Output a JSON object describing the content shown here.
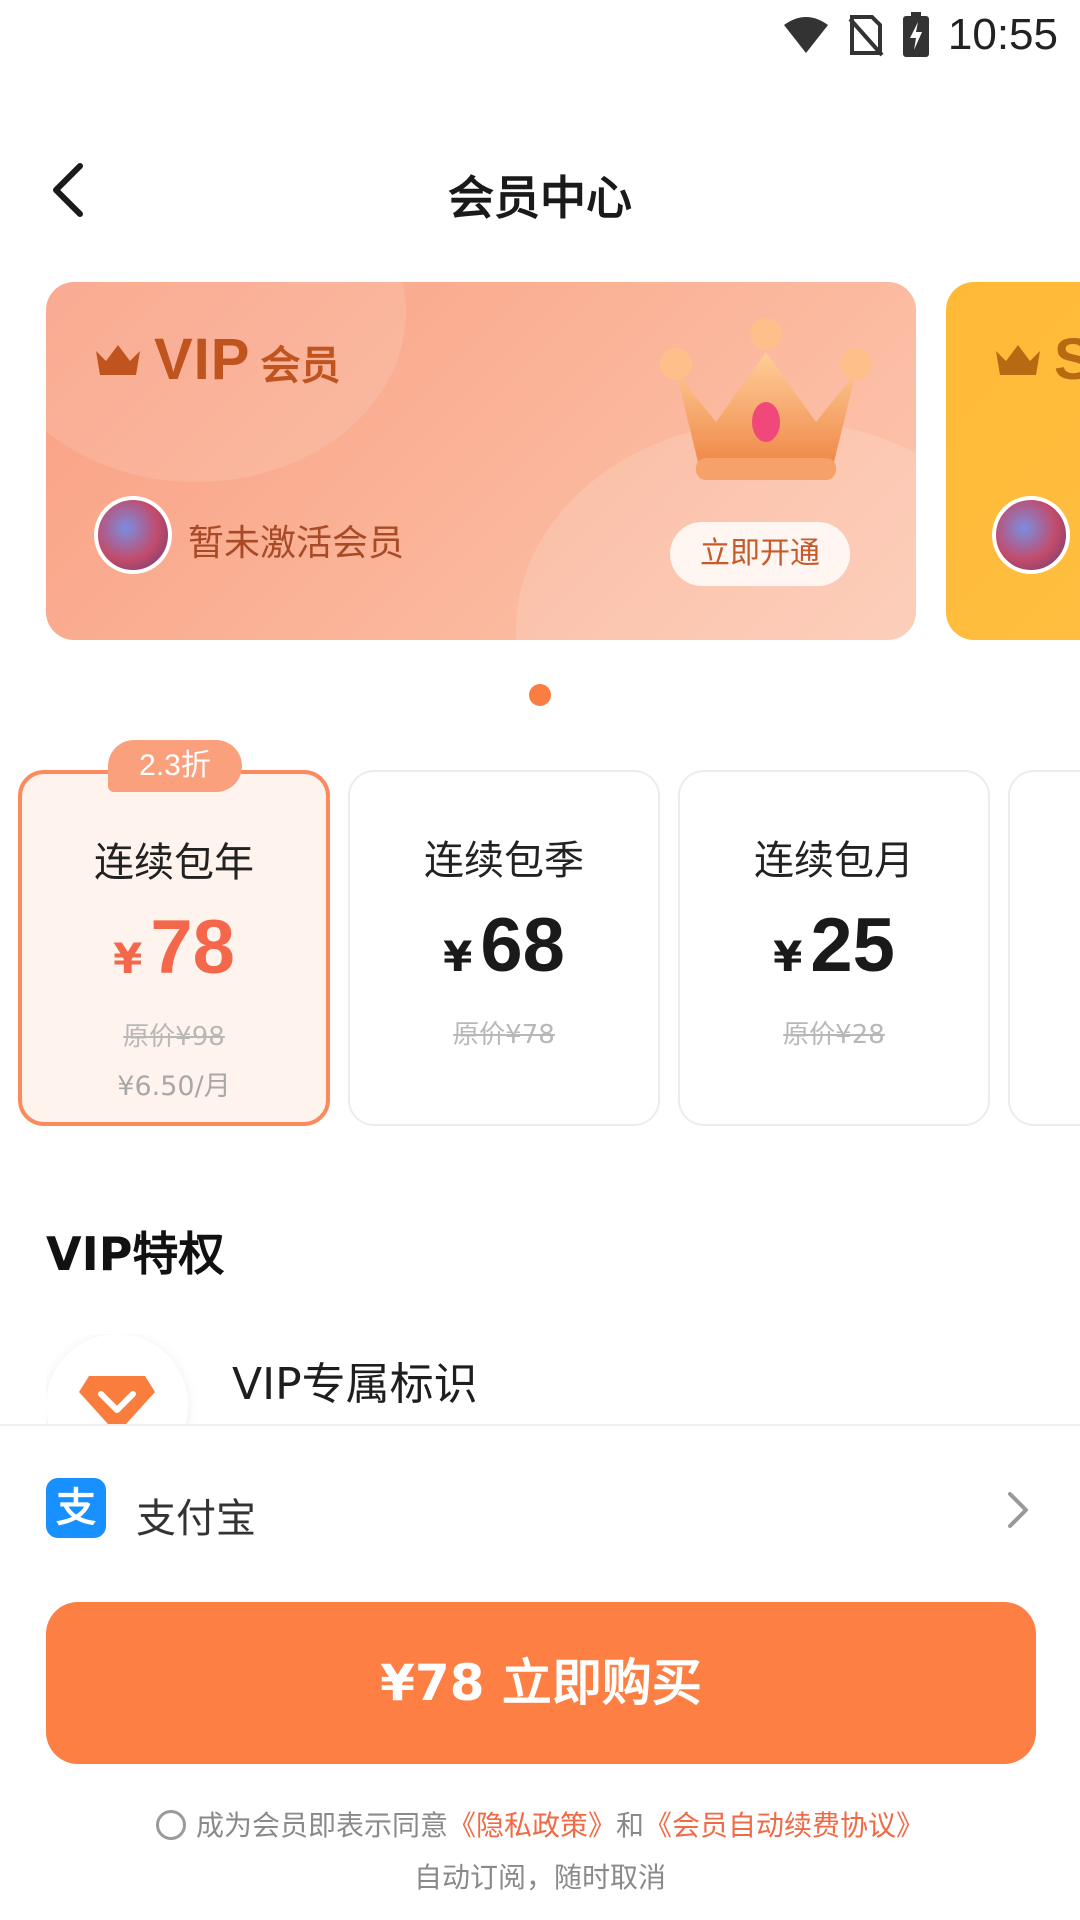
{
  "status_bar": {
    "time": "10:55"
  },
  "header": {
    "title": "会员中心"
  },
  "banner": {
    "vip_card": {
      "title_big": "VIP",
      "title_small": "会员",
      "member_status": "暂未激活会员",
      "activate_label": "立即开通"
    },
    "svip_card": {
      "title_big": "SV"
    }
  },
  "plans": [
    {
      "badge": "2.3折",
      "name": "连续包年",
      "currency": "¥",
      "price": "78",
      "original": "原价¥98",
      "per_month": "¥6.50/月",
      "selected": true
    },
    {
      "name": "连续包季",
      "currency": "¥",
      "price": "68",
      "original": "原价¥78"
    },
    {
      "name": "连续包月",
      "currency": "¥",
      "price": "25",
      "original": "原价¥28"
    }
  ],
  "privileges": {
    "title": "VIP特权",
    "items": [
      {
        "name": "VIP专属标识"
      }
    ]
  },
  "payment": {
    "method": "支付宝",
    "logo_char": "支"
  },
  "buy_button": {
    "label": "¥78 立即购买"
  },
  "agreement": {
    "prefix": "成为会员即表示同意",
    "privacy_link": "《隐私政策》",
    "and": "和",
    "renewal_link": "《会员自动续费协议》",
    "line2": "自动订阅，随时取消"
  },
  "colors": {
    "accent": "#fd7f43",
    "vip_card": "#f9a083",
    "svip_card": "#ffb936",
    "price_highlight": "#f4674a",
    "link": "#f06a45"
  },
  "icons": [
    "wifi-icon",
    "no-sim-icon",
    "battery-charging-icon",
    "back-arrow-icon",
    "crown-icon",
    "diamond-icon",
    "alipay-icon",
    "chevron-right-icon",
    "radio-icon"
  ]
}
